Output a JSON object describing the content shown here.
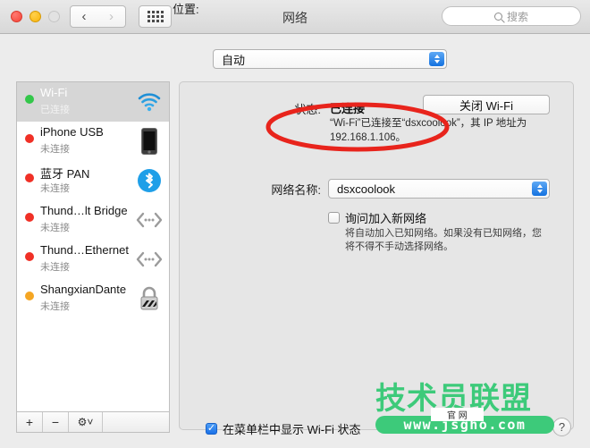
{
  "window": {
    "title": "网络",
    "traffic_lights": [
      "close",
      "minimize",
      "zoom"
    ],
    "nav": {
      "back": "‹",
      "forward": "›"
    },
    "grid_button": "all-preferences"
  },
  "search": {
    "placeholder": "搜索",
    "value": ""
  },
  "location": {
    "label": "位置:",
    "value": "自动"
  },
  "sidebar": {
    "services": [
      {
        "name": "Wi-Fi",
        "status": "已连接",
        "dot": "#33c74a",
        "icon": "wifi-icon",
        "selected": true
      },
      {
        "name": "iPhone USB",
        "status": "未连接",
        "dot": "#f03026",
        "icon": "iphone-icon",
        "selected": false
      },
      {
        "name": "蓝牙 PAN",
        "status": "未连接",
        "dot": "#f03026",
        "icon": "bluetooth-icon",
        "selected": false
      },
      {
        "name": "Thund…lt Bridge",
        "status": "未连接",
        "dot": "#f03026",
        "icon": "thunderbolt-bridge-icon",
        "selected": false
      },
      {
        "name": "Thund…Ethernet",
        "status": "未连接",
        "dot": "#f03026",
        "icon": "thunderbolt-ethernet-icon",
        "selected": false
      },
      {
        "name": "ShangxianDante",
        "status": "未连接",
        "dot": "#f5a623",
        "icon": "vpn-lock-icon",
        "selected": false
      }
    ],
    "toolbar": {
      "add": "+",
      "remove": "−",
      "actions": "gear-icon"
    }
  },
  "panel": {
    "status_label": "状态:",
    "status_value": "已连接",
    "status_detail": "“Wi-Fi”已连接至“dsxcoolook”，其 IP 地址为 192.168.1.106。",
    "toggle_button": "关闭 Wi-Fi",
    "network_name_label": "网络名称:",
    "network_name_value": "dsxcoolook",
    "ask_join_label": "询问加入新网络",
    "ask_join_checked": false,
    "ask_join_description": "将自动加入已知网络。如果没有已知网络，您将不得不手动选择网络。",
    "menubar_label": "在菜单栏中显示 Wi-Fi 状态",
    "menubar_checked": true,
    "help_button": "?"
  },
  "annotation": {
    "shape": "ellipse",
    "color": "#e8241c"
  },
  "watermark": {
    "main": "技术员联盟",
    "sub": "官 网",
    "url": "www.jsgho.com",
    "color": "#3dca7a"
  }
}
